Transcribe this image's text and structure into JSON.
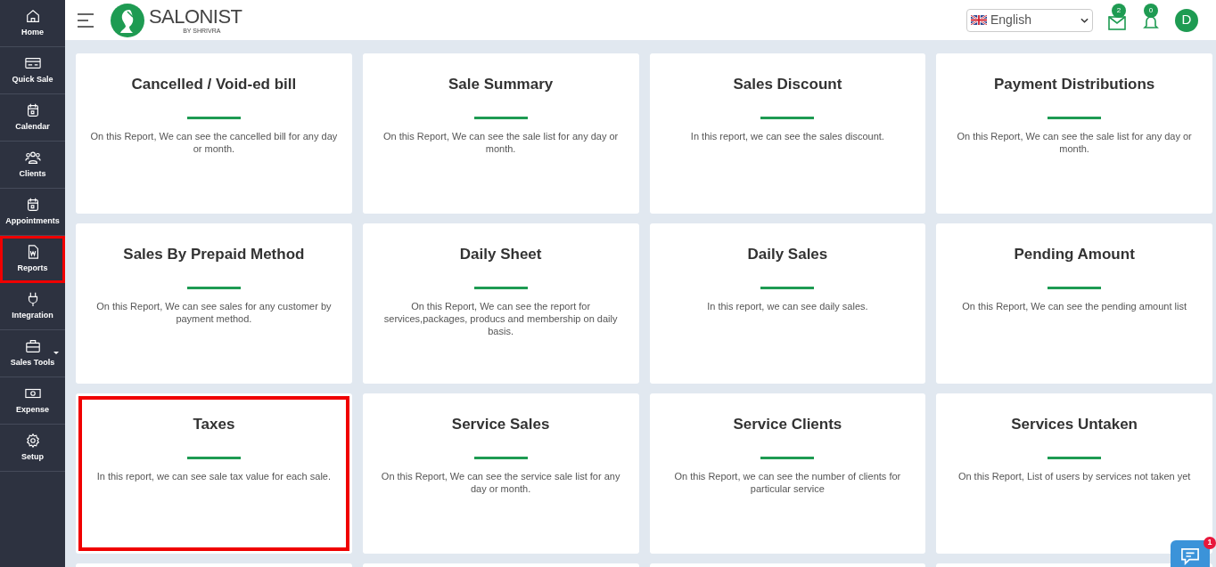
{
  "sidebar": {
    "items": [
      {
        "label": "Home",
        "highlighted": false
      },
      {
        "label": "Quick Sale",
        "highlighted": false
      },
      {
        "label": "Calendar",
        "highlighted": false
      },
      {
        "label": "Clients",
        "highlighted": false
      },
      {
        "label": "Appointments",
        "highlighted": false
      },
      {
        "label": "Reports",
        "highlighted": true
      },
      {
        "label": "Integration",
        "highlighted": false
      },
      {
        "label": "Sales Tools",
        "highlighted": false,
        "has_submenu": true
      },
      {
        "label": "Expense",
        "highlighted": false
      },
      {
        "label": "Setup",
        "highlighted": false
      }
    ]
  },
  "header": {
    "logo": {
      "name": "SALONIST",
      "tagline": "BY SHRIVRA"
    },
    "language": "English",
    "messages_count": "2",
    "notifications_count": "0",
    "avatar": "D"
  },
  "cards": [
    {
      "title": "Cancelled / Void-ed bill",
      "description": "On this Report, We can see the cancelled bill for any day or month.",
      "highlighted": false
    },
    {
      "title": "Sale Summary",
      "description": "On this Report, We can see the sale list for any day or month.",
      "highlighted": false
    },
    {
      "title": "Sales Discount",
      "description": "In this report, we can see the sales discount.",
      "highlighted": false
    },
    {
      "title": "Payment Distributions",
      "description": "On this Report, We can see the sale list for any day or month.",
      "highlighted": false
    },
    {
      "title": "Sales By Prepaid Method",
      "description": "On this Report, We can see sales for any customer by payment method.",
      "highlighted": false
    },
    {
      "title": "Daily Sheet",
      "description": "On this Report, We can see the report for services,packages, producs and membership on daily basis.",
      "highlighted": false
    },
    {
      "title": "Daily Sales",
      "description": "In this report, we can see daily sales.",
      "highlighted": false
    },
    {
      "title": "Pending Amount",
      "description": "On this Report, We can see the pending amount list",
      "highlighted": false
    },
    {
      "title": "Taxes",
      "description": "In this report, we can see sale tax value for each sale.",
      "highlighted": true
    },
    {
      "title": "Service Sales",
      "description": "On this Report, We can see the service sale list for any day or month.",
      "highlighted": false
    },
    {
      "title": "Service Clients",
      "description": "On this Report, we can see the number of clients for particular service",
      "highlighted": false
    },
    {
      "title": "Services Untaken",
      "description": "On this Report, List of users by services not taken yet",
      "highlighted": false
    }
  ],
  "chat": {
    "badge": "1"
  }
}
